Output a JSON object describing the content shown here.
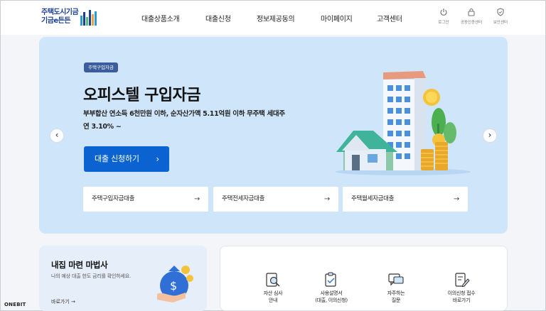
{
  "logo": {
    "line1": "주택도시기금",
    "line2": "기금e든든"
  },
  "nav": [
    "대출상품소개",
    "대출신청",
    "정보제공동의",
    "마이페이지",
    "고객센터"
  ],
  "utility": [
    {
      "label": "로그인",
      "icon": "power-icon"
    },
    {
      "label": "공동인증센터",
      "icon": "lock-icon"
    },
    {
      "label": "보안센터",
      "icon": "shield-icon"
    }
  ],
  "hero": {
    "badge": "주택구입자금",
    "title": "오피스텔 구입자금",
    "desc_line1": "부부합산 연소득 6천만원 이하, 순자산가액 5.11억원 이하 무주택 세대주",
    "desc_line2": "연 3.10% ~",
    "cta": "대출 신청하기",
    "cta_arrow": "›",
    "prev": "‹",
    "next": "›",
    "quick_links": [
      "주택구입자금대출",
      "주택전세자금대출",
      "주택월세자금대출"
    ],
    "quick_arrow": "→"
  },
  "wizard": {
    "title": "내집 마련 마법사",
    "subtitle": "나의 예상 대출 한도 금리를 확인하세요.",
    "link": "바로가기 →"
  },
  "services": [
    {
      "line1": "자산 심사",
      "line2": "안내",
      "icon": "asset-review-icon"
    },
    {
      "line1": "사용설명서",
      "line2": "(대출, 이의신청)",
      "icon": "manual-icon"
    },
    {
      "line1": "자주하는",
      "line2": "질문",
      "icon": "faq-icon"
    },
    {
      "line1": "이의신청 접수",
      "line2": "바로가기",
      "icon": "objection-icon"
    }
  ],
  "footer_brand": "ONEBIT",
  "colors": {
    "primary": "#0a63d1",
    "hero_bg": "#cfe6fa",
    "badge": "#3c5d9b"
  }
}
